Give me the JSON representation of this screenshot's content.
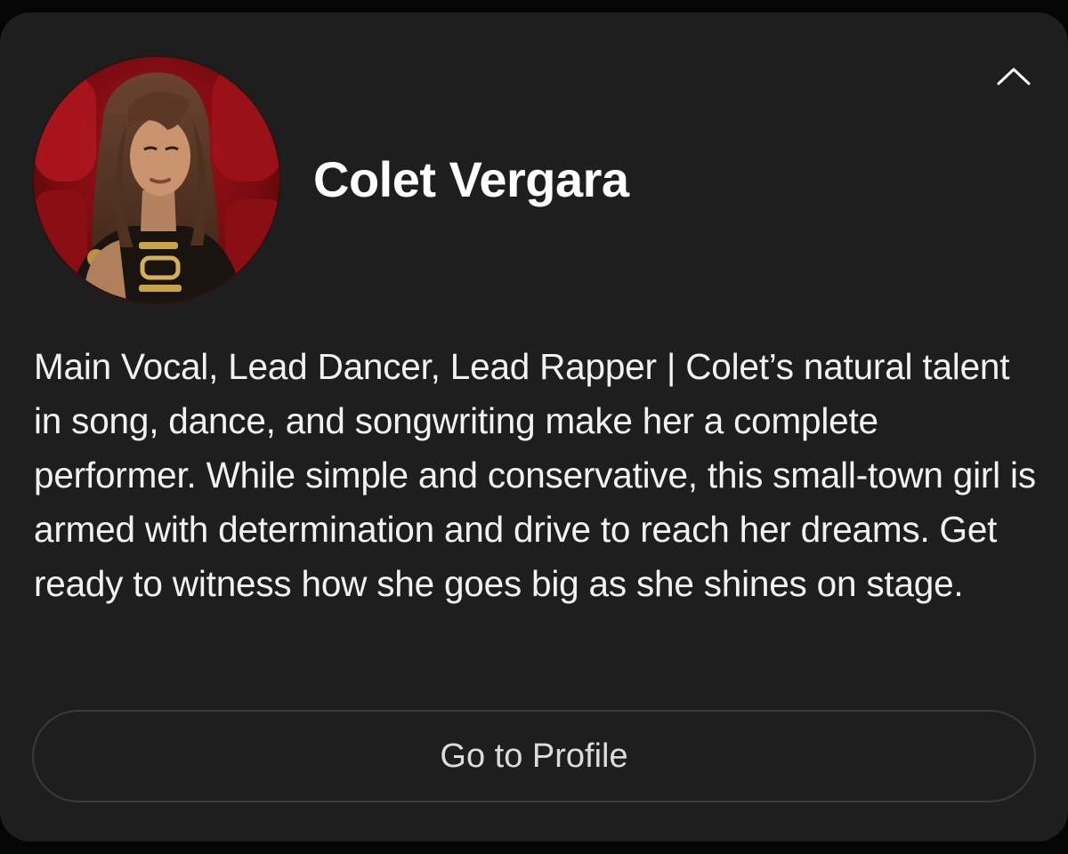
{
  "artist": {
    "name": "Colet Vergara",
    "bio": "Main Vocal, Lead Dancer, Lead Rapper | Colet’s natural talent in song, dance, and songwriting make her a complete performer. While simple and conservative, this small-town girl is armed with determination and drive to reach her dreams. Get ready to witness how she goes big as she shines on stage."
  },
  "actions": {
    "profile_button_label": "Go to Profile"
  },
  "icons": {
    "collapse": "chevron-up-icon"
  },
  "colors": {
    "background": "#050505",
    "card": "#1e1e1e",
    "text_primary": "#ffffff",
    "button_border": "#3a3a3a"
  }
}
